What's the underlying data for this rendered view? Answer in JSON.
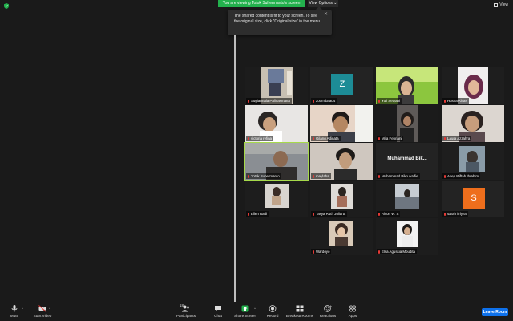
{
  "banner": {
    "sharing_text": "You are viewing Totok Suhermanto's screen",
    "view_options_label": "View Options",
    "view_label": "View"
  },
  "tooltip": {
    "text": "The shared content is fit to your screen. To see the original size, click \"Original size\" in the menu."
  },
  "participants": [
    {
      "name": "Sugiarmala Palinasmana",
      "type": "video"
    },
    {
      "name": "zoom baa04",
      "type": "avatar",
      "initial": "Z"
    },
    {
      "name": "Yuli Setyani",
      "type": "video"
    },
    {
      "name": "Husna Alnas",
      "type": "video"
    },
    {
      "name": "victoria refina",
      "type": "video"
    },
    {
      "name": "Gilang Adinata",
      "type": "video"
    },
    {
      "name": "Mita Febriani",
      "type": "video"
    },
    {
      "name": "Laura Azzahra",
      "type": "video"
    },
    {
      "name": "Totok Suhermanto",
      "type": "video",
      "active": true
    },
    {
      "name": "maylaha",
      "type": "video"
    },
    {
      "name": "Muhammad Biko waffie",
      "type": "name",
      "display": "Muhammad Bik..."
    },
    {
      "name": "Asep Miftah Ibrahim",
      "type": "video"
    },
    {
      "name": "Ellen Radi",
      "type": "video"
    },
    {
      "name": "Tasya Ruth Juliana",
      "type": "video"
    },
    {
      "name": "Alvon W. S",
      "type": "video"
    },
    {
      "name": "sarah firlyza",
      "type": "avatar",
      "initial": "S"
    },
    {
      "name": "Wardoyo",
      "type": "video"
    },
    {
      "name": "Elsa Agussia Moudita",
      "type": "video"
    }
  ],
  "toolbar": {
    "mute": "Mute",
    "start_video": "Start Video",
    "participants": "Participants",
    "participants_count": "18",
    "chat": "Chat",
    "share_screen": "Share Screen",
    "record": "Record",
    "breakout_rooms": "Breakout Rooms",
    "reactions": "Reactions",
    "apps": "Apps",
    "leave": "Leave Room"
  },
  "colors": {
    "accent_green": "#23b14d",
    "active_border": "#a6d94a",
    "leave_blue": "#0e71eb",
    "avatar_teal": "#1d8c96",
    "avatar_orange": "#ee6e1c"
  }
}
